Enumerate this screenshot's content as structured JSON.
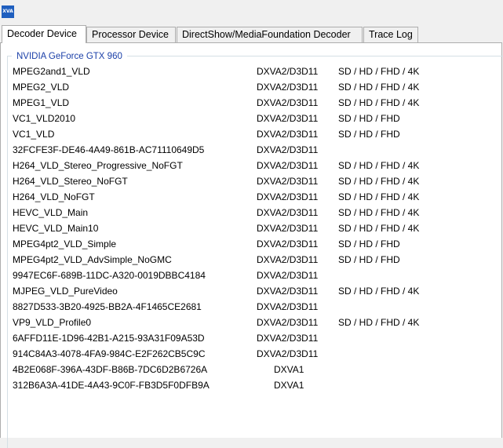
{
  "window": {
    "app_icon_text": "XVA"
  },
  "tabs": [
    {
      "label": "Decoder Device",
      "active": true
    },
    {
      "label": "Processor Device",
      "active": false
    },
    {
      "label": "DirectShow/MediaFoundation Decoder",
      "active": false
    },
    {
      "label": "Trace Log",
      "active": false
    }
  ],
  "group": {
    "title": "NVIDIA GeForce GTX 960"
  },
  "decoders": [
    {
      "name": "MPEG2and1_VLD",
      "api": "DXVA2/D3D11",
      "resolutions": "SD / HD / FHD / 4K"
    },
    {
      "name": "MPEG2_VLD",
      "api": "DXVA2/D3D11",
      "resolutions": "SD / HD / FHD / 4K"
    },
    {
      "name": "MPEG1_VLD",
      "api": "DXVA2/D3D11",
      "resolutions": "SD / HD / FHD / 4K"
    },
    {
      "name": "VC1_VLD2010",
      "api": "DXVA2/D3D11",
      "resolutions": "SD / HD / FHD"
    },
    {
      "name": "VC1_VLD",
      "api": "DXVA2/D3D11",
      "resolutions": "SD / HD / FHD"
    },
    {
      "name": "32FCFE3F-DE46-4A49-861B-AC71110649D5",
      "api": "DXVA2/D3D11",
      "resolutions": ""
    },
    {
      "name": "H264_VLD_Stereo_Progressive_NoFGT",
      "api": "DXVA2/D3D11",
      "resolutions": "SD / HD / FHD / 4K"
    },
    {
      "name": "H264_VLD_Stereo_NoFGT",
      "api": "DXVA2/D3D11",
      "resolutions": "SD / HD / FHD / 4K"
    },
    {
      "name": "H264_VLD_NoFGT",
      "api": "DXVA2/D3D11",
      "resolutions": "SD / HD / FHD / 4K"
    },
    {
      "name": "HEVC_VLD_Main",
      "api": "DXVA2/D3D11",
      "resolutions": "SD / HD / FHD / 4K"
    },
    {
      "name": "HEVC_VLD_Main10",
      "api": "DXVA2/D3D11",
      "resolutions": "SD / HD / FHD / 4K"
    },
    {
      "name": "MPEG4pt2_VLD_Simple",
      "api": "DXVA2/D3D11",
      "resolutions": "SD / HD / FHD"
    },
    {
      "name": "MPEG4pt2_VLD_AdvSimple_NoGMC",
      "api": "DXVA2/D3D11",
      "resolutions": "SD / HD / FHD"
    },
    {
      "name": "9947EC6F-689B-11DC-A320-0019DBBC4184",
      "api": "DXVA2/D3D11",
      "resolutions": ""
    },
    {
      "name": "MJPEG_VLD_PureVideo",
      "api": "DXVA2/D3D11",
      "resolutions": "SD / HD / FHD / 4K"
    },
    {
      "name": "8827D533-3B20-4925-BB2A-4F1465CE2681",
      "api": "DXVA2/D3D11",
      "resolutions": ""
    },
    {
      "name": "VP9_VLD_Profile0",
      "api": "DXVA2/D3D11",
      "resolutions": "SD / HD / FHD / 4K"
    },
    {
      "name": "6AFFD11E-1D96-42B1-A215-93A31F09A53D",
      "api": "DXVA2/D3D11",
      "resolutions": ""
    },
    {
      "name": "914C84A3-4078-4FA9-984C-E2F262CB5C9C",
      "api": "DXVA2/D3D11",
      "resolutions": ""
    },
    {
      "name": "4B2E068F-396A-43DF-B86B-7DC6D2B6726A",
      "api": "DXVA1",
      "resolutions": ""
    },
    {
      "name": "312B6A3A-41DE-4A43-9C0F-FB3D5F0DFB9A",
      "api": "DXVA1",
      "resolutions": ""
    }
  ]
}
